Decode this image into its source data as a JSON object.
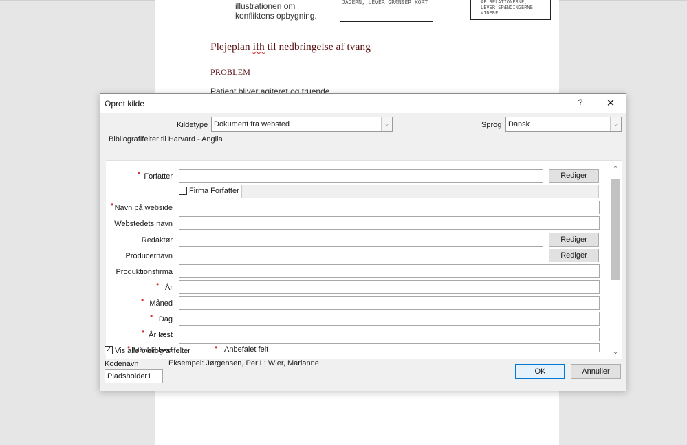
{
  "document": {
    "illus_line1": "illustrationen om",
    "illus_line2": "konfliktens opbygning.",
    "box1_text": "JAGERN, LEVER GRÆNSER KORT",
    "box2_text": "AF RELATIONERNE, LEVER SPÆNDINGERNE VIDERE",
    "heading_pre": "Plejeplan ",
    "heading_squiggle": "ifh",
    "heading_post": " til nedbringelse af tvang",
    "subheading": "PROBLEM",
    "paragraph": "Patient bliver agiteret og truende."
  },
  "dialog": {
    "title": "Opret kilde",
    "help_label": "?",
    "close_label": "✕",
    "source_type_label": "Kildetype",
    "source_type_mnemonic": "i",
    "source_type_value": "Dokument fra websted",
    "language_label": "Sprog",
    "language_value": "Dansk",
    "group_label": "Bibliografifelter til Harvard - Anglia",
    "edit_label": "Rediger",
    "corporate_author_label": "Firma Forfatter",
    "fields": [
      {
        "label": "Forfatter",
        "recommended": true,
        "value": ""
      },
      {
        "label": "Navn på webside",
        "recommended": true,
        "value": ""
      },
      {
        "label": "Webstedets navn",
        "recommended": false,
        "value": ""
      },
      {
        "label": "Redaktør",
        "recommended": false,
        "value": ""
      },
      {
        "label": "Producernavn",
        "recommended": false,
        "value": ""
      },
      {
        "label": "Produktionsfirma",
        "recommended": false,
        "value": ""
      },
      {
        "label": "År",
        "recommended": true,
        "value": ""
      },
      {
        "label": "Måned",
        "recommended": true,
        "value": ""
      },
      {
        "label": "Dag",
        "recommended": true,
        "value": ""
      },
      {
        "label": "År læst",
        "recommended": true,
        "value": ""
      },
      {
        "label": "Måned læst",
        "recommended": true,
        "value": ""
      }
    ],
    "show_all_label": "Vis alle bibliografifelter",
    "show_all_checked": true,
    "recommended_note": "Anbefalet felt",
    "tag_name_label": "Kodenavn",
    "example_text": "Eksempel: Jørgensen, Per L; Wier, Marianne",
    "tag_name_value": "Pladsholder1",
    "ok_label": "OK",
    "cancel_label": "Annuller",
    "star": "•"
  },
  "colors": {
    "required_star": "#d13438",
    "heading": "#5a1010",
    "primary_border": "#0078d7"
  }
}
